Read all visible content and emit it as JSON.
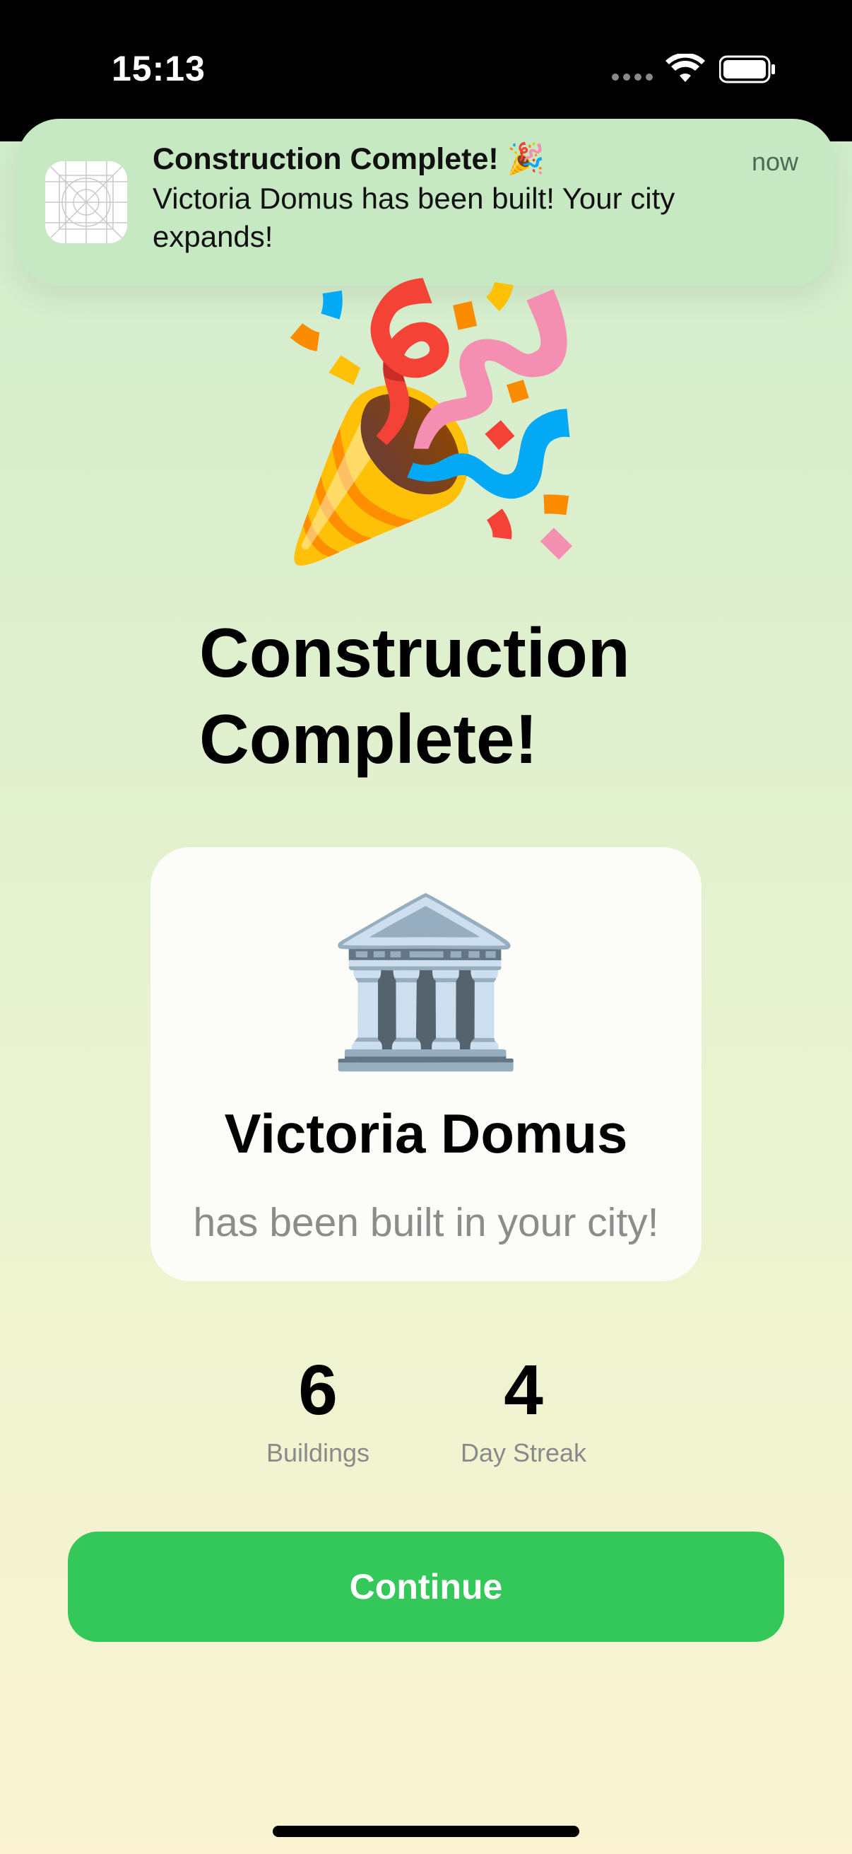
{
  "status_bar": {
    "time": "15:13"
  },
  "notification": {
    "title": "Construction Complete! 🎉",
    "body": "Victoria Domus has been built! Your city expands!",
    "time": "now",
    "app_icon": "app-placeholder-icon"
  },
  "hero": {
    "emoji": "🎉"
  },
  "headline": "Construction Complete!",
  "card": {
    "emoji": "🏛️",
    "building_name": "Victoria Domus",
    "subtitle": "has been built in your city!"
  },
  "stats": [
    {
      "value": "6",
      "label": "Buildings"
    },
    {
      "value": "4",
      "label": "Day Streak"
    }
  ],
  "continue_label": "Continue",
  "colors": {
    "accent": "#34c759",
    "bg_top": "#cdeccc",
    "bg_bottom": "#fbf3d2"
  }
}
